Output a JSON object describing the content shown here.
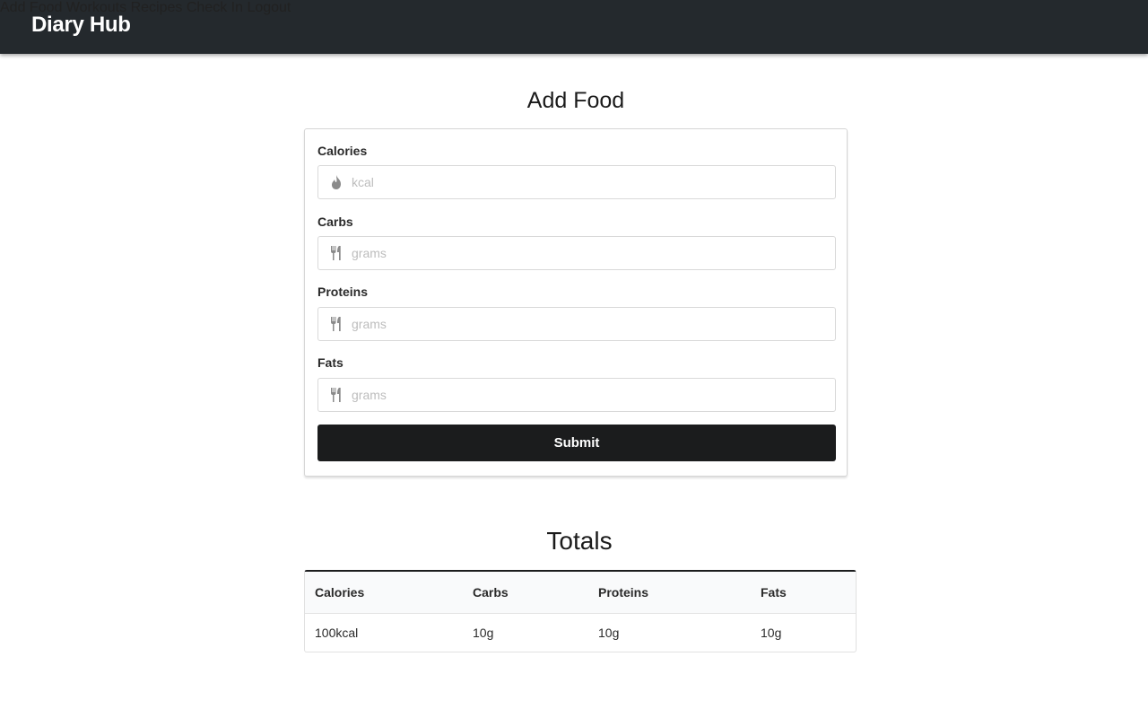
{
  "header": {
    "brand": "Diary Hub",
    "nav": [
      {
        "label": "Add Food"
      },
      {
        "label": "Workouts"
      },
      {
        "label": "Recipes"
      },
      {
        "label": "Check In"
      },
      {
        "label": "Logout"
      }
    ]
  },
  "form": {
    "title": "Add Food",
    "fields": [
      {
        "label": "Calories",
        "placeholder": "kcal",
        "value": "",
        "icon": "fire-icon"
      },
      {
        "label": "Carbs",
        "placeholder": "grams",
        "value": "",
        "icon": "utensils-icon"
      },
      {
        "label": "Proteins",
        "placeholder": "grams",
        "value": "",
        "icon": "utensils-icon"
      },
      {
        "label": "Fats",
        "placeholder": "grams",
        "value": "",
        "icon": "utensils-icon"
      }
    ],
    "submit_label": "Submit"
  },
  "totals": {
    "title": "Totals",
    "columns": [
      "Calories",
      "Carbs",
      "Proteins",
      "Fats"
    ],
    "rows": [
      [
        "100kcal",
        "10g",
        "10g",
        "10g"
      ]
    ]
  },
  "colors": {
    "topbar": "#24292d",
    "button": "#1b1c1d"
  }
}
